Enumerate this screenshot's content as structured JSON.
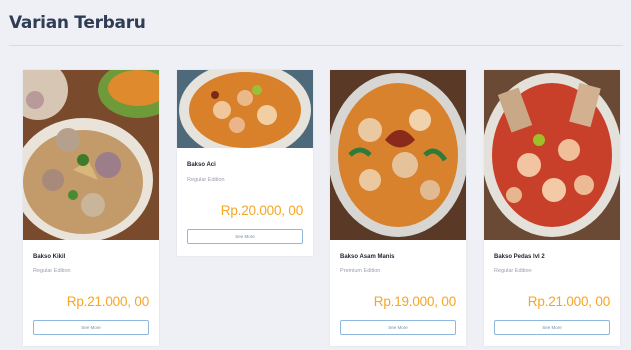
{
  "section": {
    "title": "Varian Terbaru"
  },
  "cards": [
    {
      "name": "Bakso Kikil",
      "edition": "Regular Edition",
      "price": "Rp.21.000, 00",
      "button": "See More"
    },
    {
      "name": "Bakso Aci",
      "edition": "Regular Edition",
      "price": "Rp.20.000, 00",
      "button": "See More"
    },
    {
      "name": "Bakso Asam Manis",
      "edition": "Premium Edition",
      "price": "Rp.19.000, 00",
      "button": "See More"
    },
    {
      "name": "Bakso Pedas lvl 2",
      "edition": "Regular Edition",
      "price": "Rp.21.000, 00",
      "button": "See More"
    }
  ],
  "colors": {
    "accent_price": "#f5a623",
    "title": "#2f3d55",
    "button_border": "#8fb8dc",
    "background": "#eef0f6"
  },
  "icons": []
}
